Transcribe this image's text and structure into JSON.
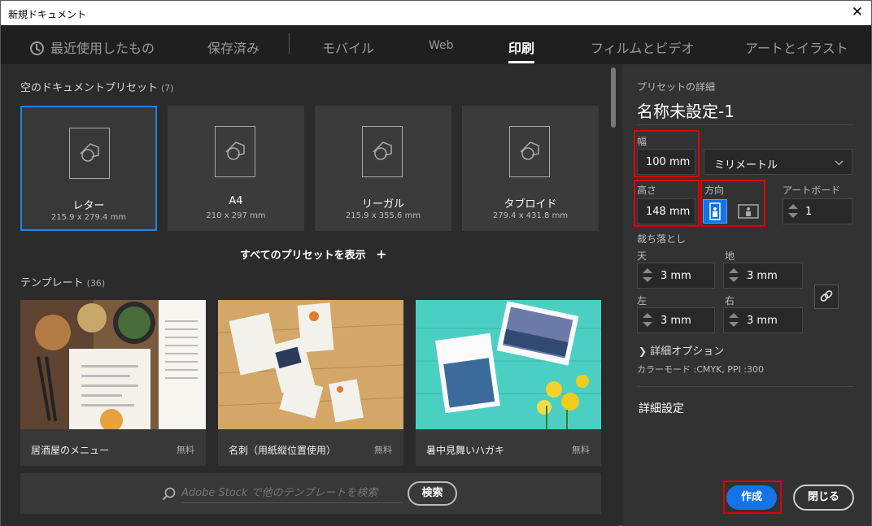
{
  "window": {
    "title": "新規ドキュメント",
    "close_glyph": "✕"
  },
  "tabs": [
    {
      "label": "最近使用したもの"
    },
    {
      "label": "保存済み"
    },
    {
      "label": "モバイル"
    },
    {
      "label": "Web"
    },
    {
      "label": "印刷"
    },
    {
      "label": "フィルムとビデオ"
    },
    {
      "label": "アートとイラスト"
    }
  ],
  "active_tab": "印刷",
  "presets_section": {
    "title": "空のドキュメントプリセット",
    "count": "(7)"
  },
  "presets": [
    {
      "name": "レター",
      "size": "215.9 x 279.4 mm",
      "selected": true
    },
    {
      "name": "A4",
      "size": "210 x 297 mm",
      "selected": false
    },
    {
      "name": "リーガル",
      "size": "215.9 x 355.6 mm",
      "selected": false
    },
    {
      "name": "タブロイド",
      "size": "279.4 x 431.8 mm",
      "selected": false
    }
  ],
  "show_all": {
    "label": "すべてのプリセットを表示",
    "icon": "plus-icon",
    "glyph": "+"
  },
  "templates_section": {
    "title": "テンプレート",
    "count": "(36)"
  },
  "templates": [
    {
      "name": "居酒屋のメニュー",
      "price": "無料"
    },
    {
      "name": "名刺（用紙縦位置使用）",
      "price": "無料"
    },
    {
      "name": "暑中見舞いハガキ",
      "price": "無料"
    }
  ],
  "search": {
    "placeholder": "Adobe Stock で他のテンプレートを検索",
    "button": "検索"
  },
  "details": {
    "section_label": "プリセットの詳細",
    "doc_name": "名称未設定-1",
    "width_label": "幅",
    "width_value": "100 mm",
    "unit_value": "ミリメートル",
    "height_label": "高さ",
    "height_value": "148 mm",
    "orientation_label": "方向",
    "artboard_label": "アートボード",
    "artboard_value": "1",
    "bleed_label": "裁ち落とし",
    "bleed_top_label": "天",
    "bleed_top": "3 mm",
    "bleed_bottom_label": "地",
    "bleed_bottom": "3 mm",
    "bleed_left_label": "左",
    "bleed_left": "3 mm",
    "bleed_right_label": "右",
    "bleed_right": "3 mm",
    "advanced_options": "詳細オプション",
    "color_mode": "カラーモード :CMYK, PPI :300",
    "more_settings": "詳細設定"
  },
  "actions": {
    "create": "作成",
    "close": "閉じる"
  },
  "colors": {
    "accent": "#1473e6",
    "selection": "#2680eb",
    "highlight": "#e00000"
  }
}
